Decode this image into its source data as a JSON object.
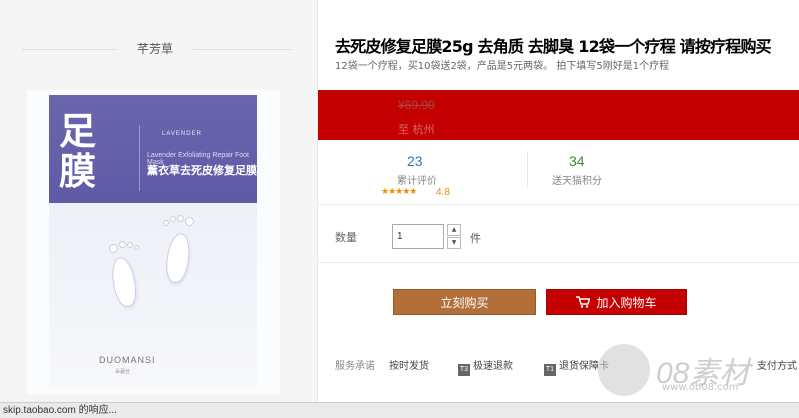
{
  "store": {
    "name": "芊芳草"
  },
  "product_image": {
    "title": "足膜",
    "name_cn": "薰衣草去死皮修复足膜",
    "name_en": "Lavender Exfoliating Repair Foot Mask",
    "series": "LAVENDER",
    "brand": "DUOMANSI",
    "brand_cn": "朵蔓丝"
  },
  "product": {
    "title": "去死皮修复足膜25g 去角质 去脚臭 12袋一个疗程 请按疗程购买",
    "subtitle": "12袋一个疗程，买10袋送2袋，产品是5元两袋。 拍下填写5刚好是1个疗程"
  },
  "price": {
    "value": "¥69.90",
    "shipping": "至 杭州"
  },
  "stats": {
    "reviews_count": "23",
    "reviews_label": "累计评价",
    "points_count": "34",
    "points_label": "送天猫积分",
    "stars": "★★★★★",
    "rating": "4.8"
  },
  "quantity": {
    "label": "数量",
    "value": "1",
    "unit": "件",
    "up": "▲",
    "down": "▼"
  },
  "actions": {
    "buy_now": "立刻购买",
    "add_to_cart": "加入购物车"
  },
  "service": {
    "label": "服务承诺",
    "items": [
      {
        "badge": "",
        "text": "按时发货"
      },
      {
        "badge": "T3",
        "text": "极速退款"
      },
      {
        "badge": "T1",
        "text": "退货保障卡"
      }
    ],
    "payment": "支付方式"
  },
  "status_bar": {
    "text": "skip.taobao.com 的响应..."
  },
  "watermark": {
    "text": "08素材",
    "domain": "www.ob08.com"
  },
  "colors": {
    "accent_red": "#c40000",
    "buy_brown": "#b26f3a",
    "pack_purple": "#6a66ad"
  }
}
